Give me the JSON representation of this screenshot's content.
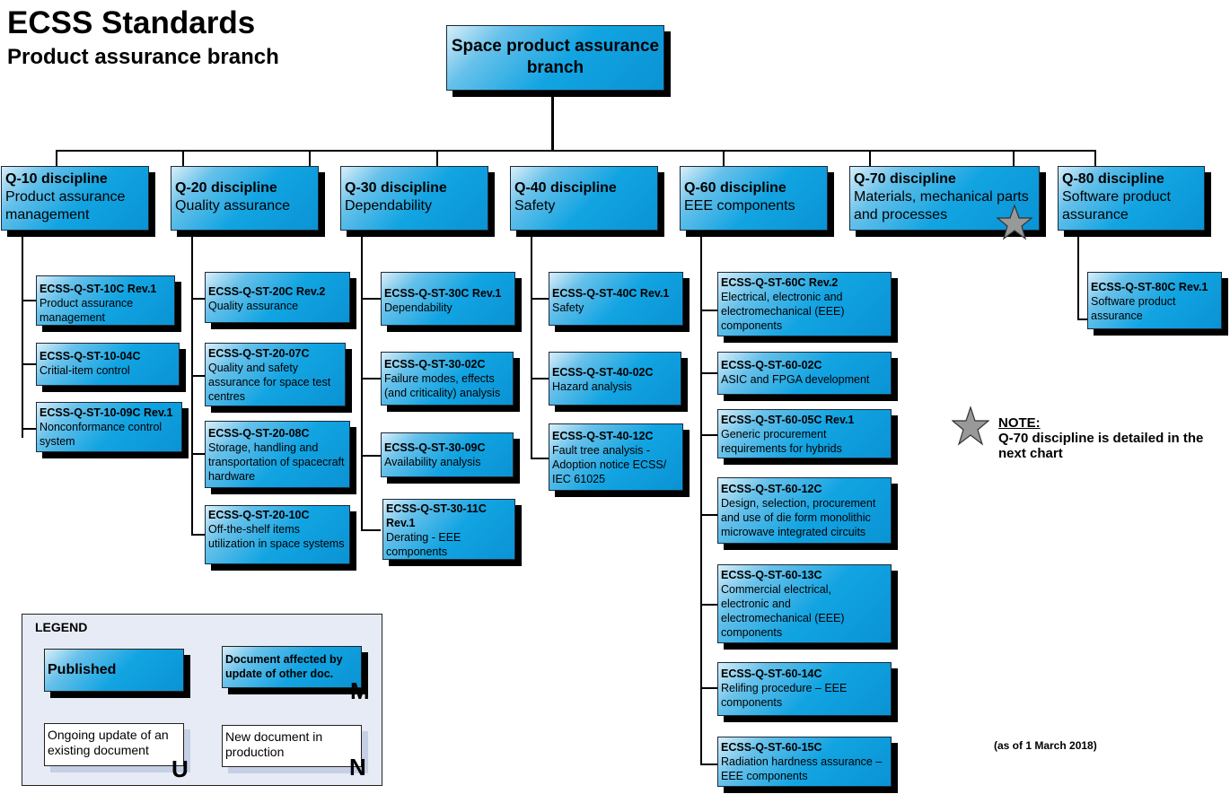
{
  "header": {
    "title": "ECSS Standards",
    "subtitle": "Product assurance branch"
  },
  "root": {
    "label": "Space product assurance branch"
  },
  "disciplines": [
    {
      "code": "Q-10 discipline",
      "name": "Product assurance management",
      "documents": [
        {
          "code": "ECSS-Q-ST-10C Rev.1",
          "name": "Product assurance management"
        },
        {
          "code": "ECSS-Q-ST-10-04C",
          "name": "Critial-item control"
        },
        {
          "code": "ECSS-Q-ST-10-09C Rev.1",
          "name": "Nonconformance control system"
        }
      ]
    },
    {
      "code": "Q-20 discipline",
      "name": "Quality assurance",
      "documents": [
        {
          "code": "ECSS-Q-ST-20C Rev.2",
          "name": "Quality assurance"
        },
        {
          "code": "ECSS-Q-ST-20-07C",
          "name": "Quality and safety assurance for space test centres"
        },
        {
          "code": "ECSS-Q-ST-20-08C",
          "name": "Storage, handling and transportation of spacecraft hardware"
        },
        {
          "code": "ECSS-Q-ST-20-10C",
          "name": "Off-the-shelf items utilization in space systems"
        }
      ]
    },
    {
      "code": "Q-30 discipline",
      "name": "Dependability",
      "documents": [
        {
          "code": "ECSS-Q-ST-30C Rev.1",
          "name": "Dependability"
        },
        {
          "code": "ECSS-Q-ST-30-02C",
          "name": "Failure modes, effects (and criticality) analysis"
        },
        {
          "code": "ECSS-Q-ST-30-09C",
          "name": "Availability analysis"
        },
        {
          "code": "ECSS-Q-ST-30-11C Rev.1",
          "name": "Derating - EEE components"
        }
      ]
    },
    {
      "code": "Q-40 discipline",
      "name": "Safety",
      "documents": [
        {
          "code": "ECSS-Q-ST-40C Rev.1",
          "name": "Safety"
        },
        {
          "code": "ECSS-Q-ST-40-02C",
          "name": "Hazard analysis"
        },
        {
          "code": "ECSS-Q-ST-40-12C",
          "name": "Fault tree analysis - Adoption notice ECSS/ IEC 61025"
        }
      ]
    },
    {
      "code": "Q-60 discipline",
      "name": "EEE components",
      "documents": [
        {
          "code": "ECSS-Q-ST-60C Rev.2",
          "name": "Electrical, electronic and electromechanical (EEE) components"
        },
        {
          "code": "ECSS-Q-ST-60-02C",
          "name": "ASIC and FPGA development"
        },
        {
          "code": "ECSS-Q-ST-60-05C Rev.1",
          "name": "Generic procurement requirements for hybrids"
        },
        {
          "code": "ECSS-Q-ST-60-12C",
          "name": "Design, selection, procurement and use of die form monolithic microwave integrated circuits"
        },
        {
          "code": "ECSS-Q-ST-60-13C",
          "name": "Commercial electrical, electronic and electromechanical (EEE) components"
        },
        {
          "code": "ECSS-Q-ST-60-14C",
          "name": "Relifing procedure – EEE components"
        },
        {
          "code": "ECSS-Q-ST-60-15C",
          "name": "Radiation hardness assurance – EEE components"
        }
      ]
    },
    {
      "code": "Q-70 discipline",
      "name": "Materials, mechanical parts and processes",
      "star": true,
      "documents": []
    },
    {
      "code": "Q-80 discipline",
      "name": "Software product assurance",
      "documents": [
        {
          "code": "ECSS-Q-ST-80C Rev.1",
          "name": "Software product assurance"
        }
      ]
    }
  ],
  "note": {
    "header": "NOTE:",
    "text": "Q-70 discipline is detailed in the next chart"
  },
  "as_of": "(as of 1 March 2018)",
  "legend": {
    "title": "LEGEND",
    "published": "Published",
    "affected": "Document affected by update of other doc.",
    "affected_mark": "M",
    "ongoing": "Ongoing update of an existing document",
    "ongoing_mark": "U",
    "new_doc": "New document in production",
    "new_mark": "N"
  },
  "colors": {
    "box_blue": "#12a4e2",
    "shadow": "#000000",
    "legend_bg": "#e6ebf5",
    "star": "#999999"
  }
}
